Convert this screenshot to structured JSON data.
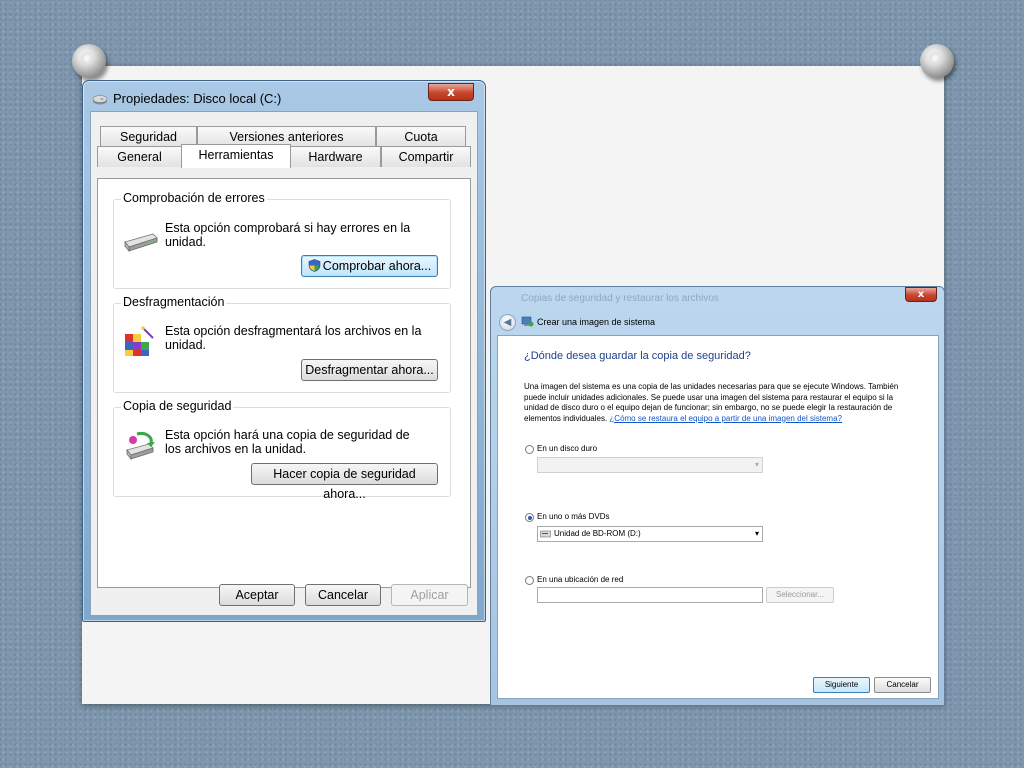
{
  "window1": {
    "title": "Propiedades: Disco local (C:)",
    "close_label": "x",
    "tabs_row1": [
      "Seguridad",
      "Versiones anteriores",
      "Cuota"
    ],
    "tabs_row2": [
      "General",
      "Herramientas",
      "Hardware",
      "Compartir"
    ],
    "active_tab": "Herramientas",
    "groups": {
      "errors": {
        "label": "Comprobación de errores",
        "text": "Esta opción comprobará si hay errores en la unidad.",
        "button": "Comprobar ahora..."
      },
      "defrag": {
        "label": "Desfragmentación",
        "text": "Esta opción desfragmentará los archivos en la unidad.",
        "button": "Desfragmentar ahora..."
      },
      "backup": {
        "label": "Copia de seguridad",
        "text": "Esta opción hará una copia de seguridad de los archivos en la unidad.",
        "button": "Hacer copia de seguridad ahora..."
      }
    },
    "footer": {
      "ok": "Aceptar",
      "cancel": "Cancelar",
      "apply": "Aplicar"
    }
  },
  "window2": {
    "ghost_title": "Copias de seguridad y restaurar los archivos",
    "close_label": "x",
    "breadcrumb_title": "Crear una imagen de sistema",
    "heading": "¿Dónde desea guardar la copia de seguridad?",
    "description": "Una imagen del sistema es una copia de las unidades necesarias para que se ejecute Windows. También puede incluir unidades adicionales. Se puede usar una imagen del sistema para restaurar el equipo si la unidad de disco duro o el equipo dejan de funcionar; sin embargo, no se puede elegir la restauración de elementos individuales.",
    "help_link": "¿Cómo se restaura el equipo a partir de una imagen del sistema?",
    "options": {
      "hard_disk": {
        "label": "En un disco duro",
        "selected": false,
        "value": ""
      },
      "dvd": {
        "label": "En uno o más DVDs",
        "selected": true,
        "value": "Unidad de BD-ROM (D:)"
      },
      "network": {
        "label": "En una ubicación de red",
        "selected": false,
        "value": "",
        "browse": "Seleccionar..."
      }
    },
    "footer": {
      "next": "Siguiente",
      "cancel": "Cancelar"
    }
  }
}
